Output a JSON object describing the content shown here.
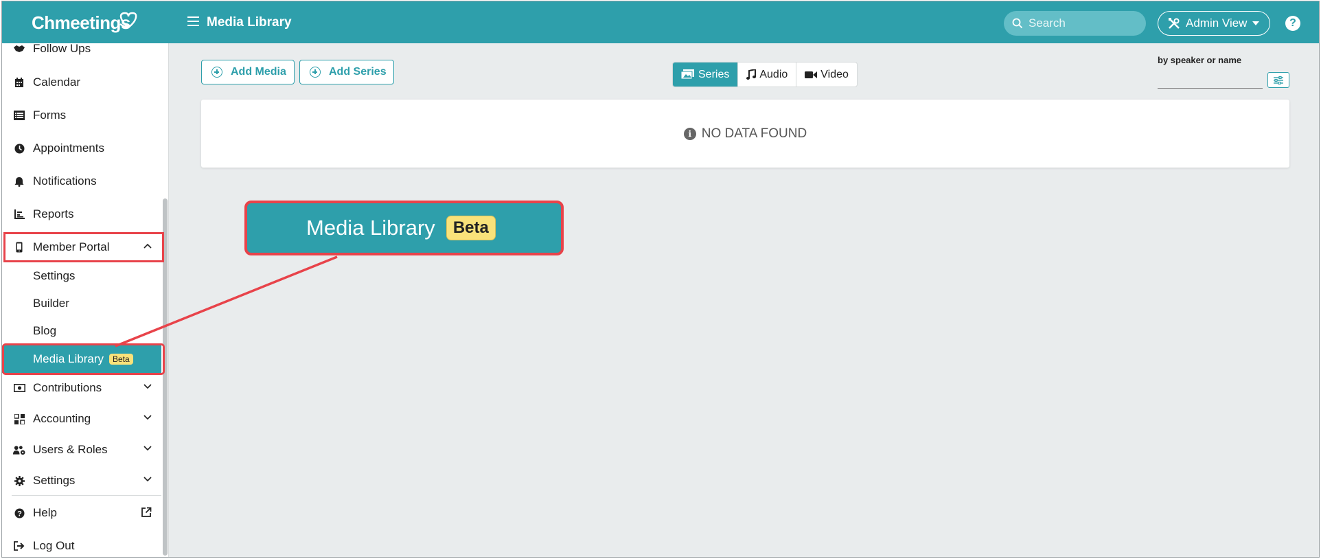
{
  "header": {
    "brand": "Chmeetings",
    "page_title": "Media Library",
    "search_placeholder": "Search",
    "admin_view_label": "Admin View",
    "help_label": "?"
  },
  "sidebar": {
    "items": [
      {
        "label": "Follow Ups",
        "icon": "handshake-icon"
      },
      {
        "label": "Calendar",
        "icon": "calendar-icon"
      },
      {
        "label": "Forms",
        "icon": "list-icon"
      },
      {
        "label": "Appointments",
        "icon": "clock-icon"
      },
      {
        "label": "Notifications",
        "icon": "bell-icon"
      },
      {
        "label": "Reports",
        "icon": "bar-chart-icon"
      },
      {
        "label": "Member Portal",
        "icon": "mobile-icon",
        "expanded": true
      },
      {
        "label": "Contributions",
        "icon": "money-icon"
      },
      {
        "label": "Accounting",
        "icon": "grid-icon"
      },
      {
        "label": "Users & Roles",
        "icon": "users-gear-icon"
      },
      {
        "label": "Settings",
        "icon": "gear-icon"
      },
      {
        "label": "Help",
        "icon": "question-circle-icon"
      },
      {
        "label": "Log Out",
        "icon": "logout-icon"
      }
    ],
    "member_portal_sub": [
      {
        "label": "Settings"
      },
      {
        "label": "Builder"
      },
      {
        "label": "Blog"
      },
      {
        "label": "Media Library",
        "badge": "Beta",
        "active": true
      }
    ]
  },
  "toolbar": {
    "add_media_label": "Add Media",
    "add_series_label": "Add Series",
    "tabs": [
      {
        "label": "Series",
        "active": true
      },
      {
        "label": "Audio",
        "active": false
      },
      {
        "label": "Video",
        "active": false
      }
    ],
    "filter_label": "by speaker or name",
    "filter_value": ""
  },
  "content": {
    "empty_message": "NO DATA FOUND"
  },
  "callout": {
    "title": "Media Library",
    "badge": "Beta"
  },
  "colors": {
    "accent": "#2e9fab",
    "highlight": "#e8434a",
    "beta_badge": "#f9e27a",
    "background": "#e9eced"
  }
}
